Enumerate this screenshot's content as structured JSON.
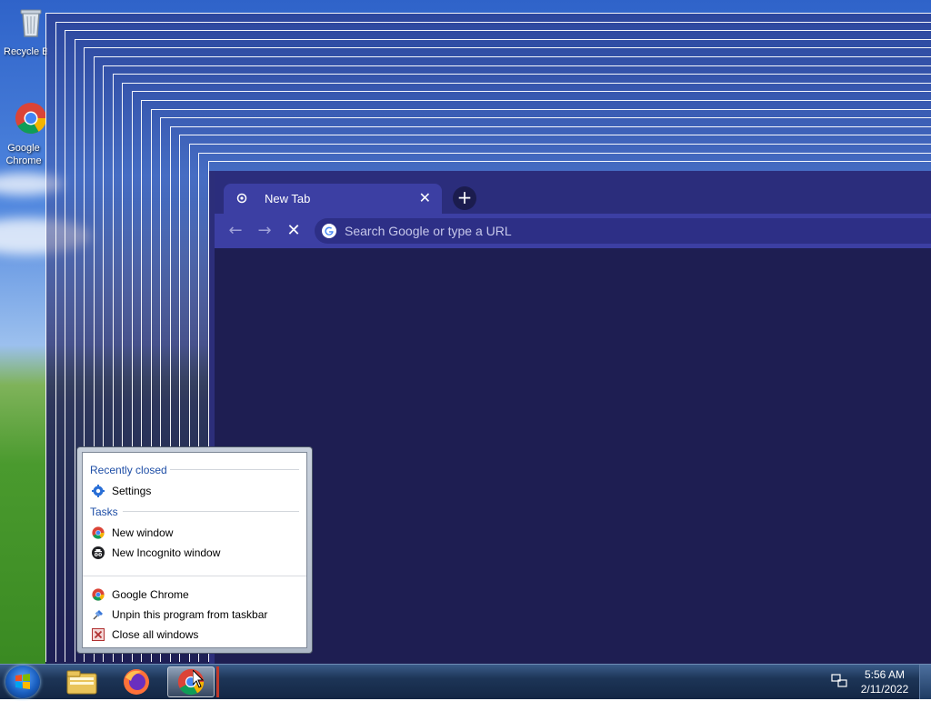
{
  "desktop": {
    "icons": [
      {
        "label": "Recycle Bin",
        "icon": "recycle-bin-icon"
      },
      {
        "label": "Google Chrome",
        "icon": "chrome-icon"
      }
    ]
  },
  "chrome_window": {
    "tab": {
      "title": "New Tab",
      "close_glyph": "✕"
    },
    "new_tab_glyph": "+",
    "toolbar": {
      "back_glyph": "←",
      "forward_glyph": "→",
      "stop_glyph": "✕",
      "omnibox_placeholder": "Search Google or type a URL"
    },
    "colors": {
      "frame": "#2b2d7c",
      "tab": "#3c3fa3",
      "content": "#1e1e52"
    }
  },
  "jumplist": {
    "recently_closed_label": "Recently closed",
    "recently_closed": [
      {
        "label": "Settings",
        "icon": "gear-icon"
      }
    ],
    "tasks_label": "Tasks",
    "tasks": [
      {
        "label": "New window",
        "icon": "chrome-icon"
      },
      {
        "label": "New Incognito window",
        "icon": "incognito-icon"
      }
    ],
    "actions": [
      {
        "label": "Google Chrome",
        "icon": "chrome-icon"
      },
      {
        "label": "Unpin this program from taskbar",
        "icon": "unpin-icon"
      },
      {
        "label": "Close all windows",
        "icon": "close-window-icon"
      }
    ]
  },
  "taskbar": {
    "apps": [
      {
        "name": "Windows Explorer",
        "icon": "folder-icon",
        "active": false
      },
      {
        "name": "Firefox",
        "icon": "firefox-icon",
        "active": false
      },
      {
        "name": "Google Chrome",
        "icon": "chrome-icon",
        "active": true
      }
    ],
    "clock": {
      "time": "5:56 AM",
      "date": "2/11/2022"
    }
  }
}
